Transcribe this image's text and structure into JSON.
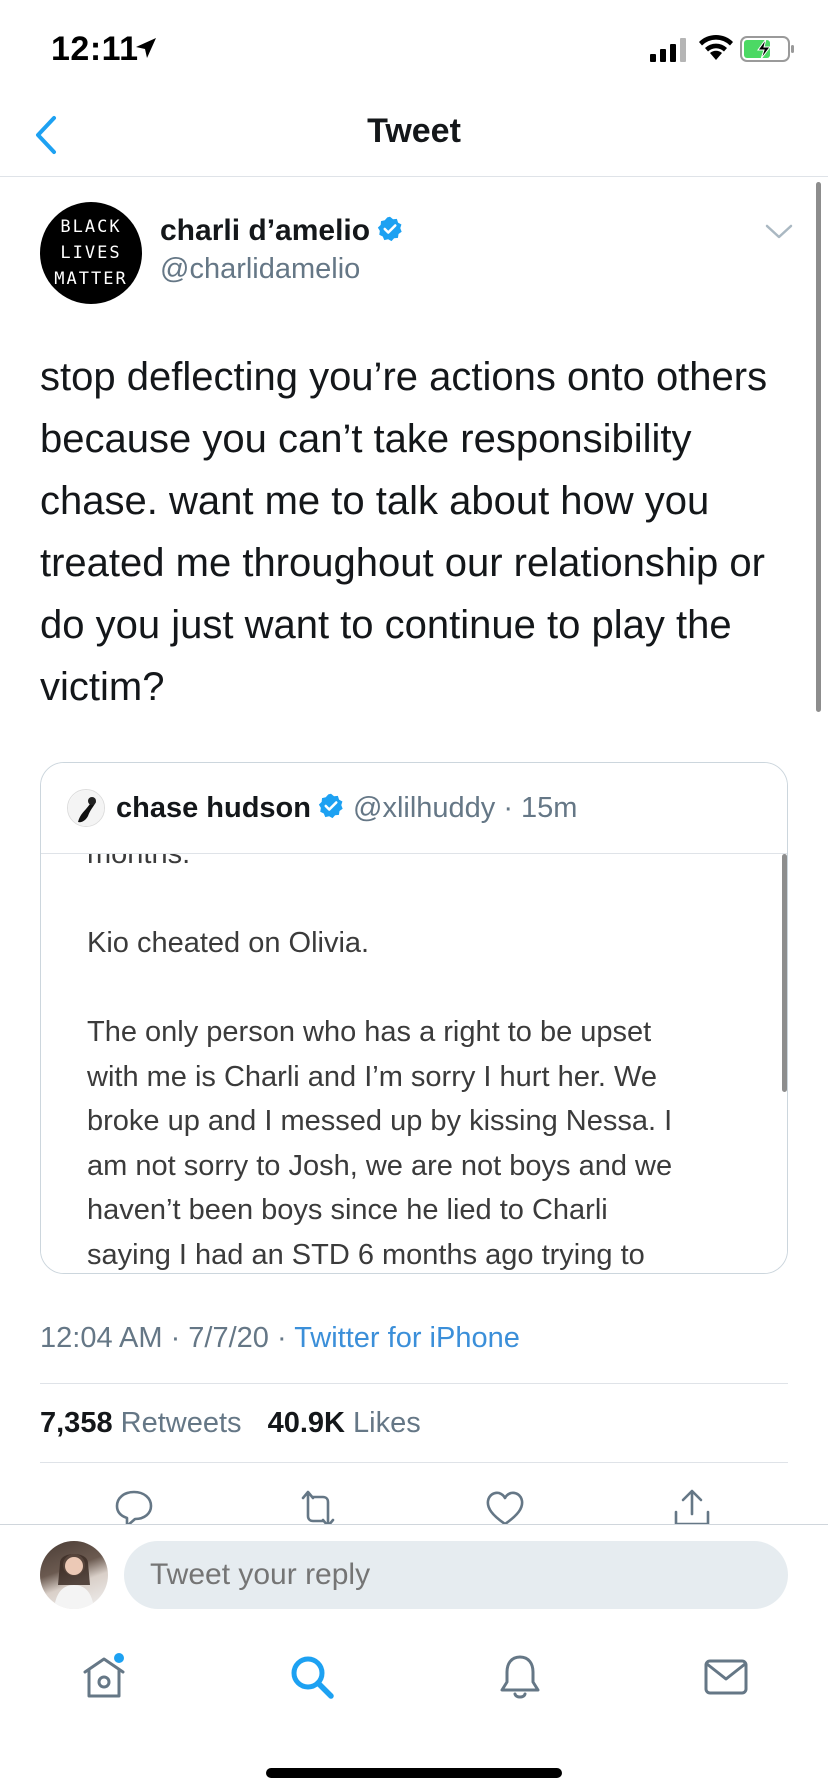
{
  "status_bar": {
    "time": "12:11"
  },
  "nav": {
    "title": "Tweet"
  },
  "tweet": {
    "avatar_text": [
      "BLACK",
      "LIVES",
      "MATTER"
    ],
    "author_name": "charli d’amelio",
    "author_handle": "@charlidamelio",
    "text": "stop deflecting you’re actions onto others because you can’t take responsibility chase. want me to talk about how you treated me throughout our relationship or do you just want to continue to play the victim?",
    "timestamp": "12:04 AM · 7/7/20 · ",
    "source": "Twitter for iPhone",
    "retweets_count": "7,358",
    "retweets_label": "Retweets",
    "likes_count": "40.9K",
    "likes_label": "Likes"
  },
  "quote": {
    "author_name": "chase hudson",
    "author_handle": "@xlilhuddy · 15m",
    "lines": [
      "months.",
      "",
      "Kio cheated on Olivia.",
      "",
      "The only person who has a right to be upset",
      "with me is Charli and I’m sorry I hurt her. We",
      "broke up and I messed up by kissing Nessa. I",
      "am not sorry to Josh, we are not boys and we",
      "haven’t been boys since he lied to Charli",
      "saying I had an STD 6 months ago trying to"
    ]
  },
  "reply": {
    "placeholder": "Tweet your reply"
  },
  "colors": {
    "accent": "#1da1f2",
    "verified": "#1da1f2",
    "muted": "#657786"
  },
  "icons": {
    "actions": [
      "reply-icon",
      "retweet-icon",
      "like-icon",
      "share-icon"
    ],
    "tabs": [
      "home-icon",
      "search-icon",
      "notifications-icon",
      "messages-icon"
    ]
  }
}
